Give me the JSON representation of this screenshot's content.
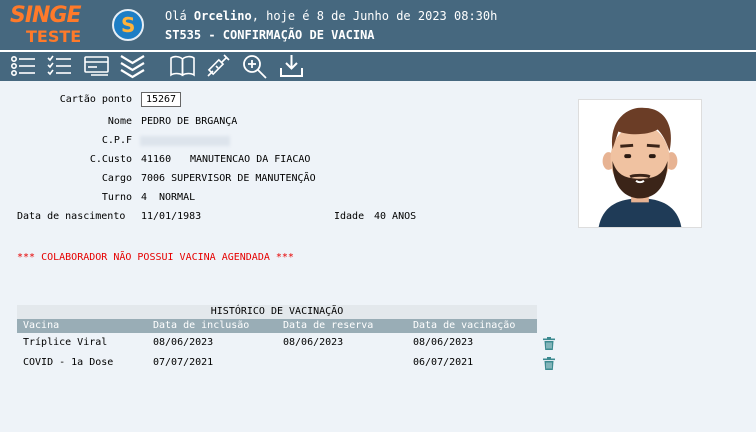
{
  "header": {
    "brand_line1": "SINGE",
    "brand_line2": "TESTE",
    "greeting_prefix": "Olá ",
    "user_name": "Orcelino",
    "greeting_suffix": ", hoje é 8 de Junho de 2023 08:30h",
    "screen_title": "ST535 - CONFIRMAÇÃO DE VACINA"
  },
  "toolbar": [
    "list-icon",
    "checklist-icon",
    "card-icon",
    "chevrons-down-icon",
    "book-icon",
    "syringe-icon",
    "zoom-in-icon",
    "download-icon"
  ],
  "form": {
    "card_label": "Cartão ponto",
    "card_value": "15267",
    "name_label": "Nome",
    "name_value": "PEDRO DE BRGANÇA",
    "cpf_label": "C.P.F",
    "cost_center_label": "C.Custo",
    "cost_center_code": "41160",
    "cost_center_name": "MANUTENCAO DA FIACAO",
    "role_label": "Cargo",
    "role_value": "7006 SUPERVISOR DE MANUTENÇÃO",
    "shift_label": "Turno",
    "shift_code": "4",
    "shift_name": "NORMAL",
    "birth_label": "Data de nascimento",
    "birth_value": "11/01/1983",
    "age_label": "Idade",
    "age_value": "40 ANOS"
  },
  "alert": "*** COLABORADOR NÃO POSSUI VACINA AGENDADA ***",
  "history": {
    "title": "HISTÓRICO DE VACINAÇÃO",
    "columns": [
      "Vacina",
      "Data de inclusão",
      "Data de reserva",
      "Data de vacinação"
    ],
    "rows": [
      [
        "Tríplice Viral",
        "08/06/2023",
        "08/06/2023",
        "08/06/2023"
      ],
      [
        "COVID - 1a Dose",
        "07/07/2021",
        "",
        "06/07/2021"
      ]
    ]
  },
  "colors": {
    "header_bg": "#46687f",
    "brand": "#ff7a2a",
    "alert": "#e60000",
    "table_head": "#99adb6",
    "trash": "#3c8a90"
  }
}
